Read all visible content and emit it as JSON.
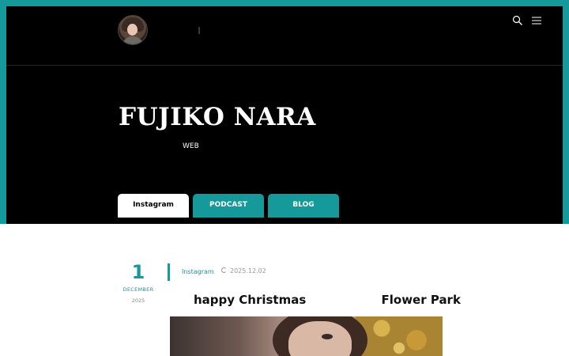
{
  "header": {
    "site_name": "　　　　　｜　　　　　",
    "icons": [
      "search-icon",
      "hamburger-menu-icon"
    ]
  },
  "hero": {
    "title": "FUJIKO NARA",
    "subtitle": "　　　　　　　　　WEB　　　　　"
  },
  "tabs": [
    {
      "label": "Instagram",
      "active": true
    },
    {
      "label": "PODCAST",
      "active": false
    },
    {
      "label": "BLOG",
      "active": false
    }
  ],
  "post": {
    "date": {
      "day": "1",
      "month": "DECEMBER",
      "year": "2025"
    },
    "category": "Instagram",
    "updated": "2025.12.02",
    "title": "　　happy Christmas　　 　　　　Flower Park　　"
  },
  "colors": {
    "accent": "#16999b",
    "hero_background": "#000000",
    "page_background": "#ffffff"
  }
}
